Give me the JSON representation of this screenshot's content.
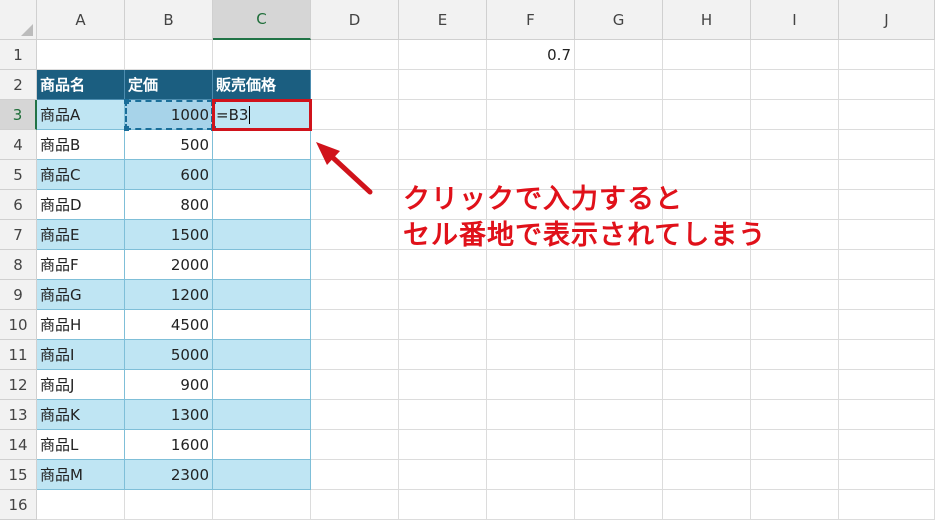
{
  "sheet": {
    "columns": [
      "A",
      "B",
      "C",
      "D",
      "E",
      "F",
      "G",
      "H",
      "I",
      "J"
    ],
    "rows": [
      "1",
      "2",
      "3",
      "4",
      "5",
      "6",
      "7",
      "8",
      "9",
      "10",
      "11",
      "12",
      "13",
      "14",
      "15",
      "16"
    ],
    "f1_value": "0.7",
    "table": {
      "headers": [
        "商品名",
        "定価",
        "販売価格"
      ],
      "items": [
        {
          "name": "商品A",
          "price": "1000"
        },
        {
          "name": "商品B",
          "price": "500"
        },
        {
          "name": "商品C",
          "price": "600"
        },
        {
          "name": "商品D",
          "price": "800"
        },
        {
          "name": "商品E",
          "price": "1500"
        },
        {
          "name": "商品F",
          "price": "2000"
        },
        {
          "name": "商品G",
          "price": "1200"
        },
        {
          "name": "商品H",
          "price": "4500"
        },
        {
          "name": "商品I",
          "price": "5000"
        },
        {
          "name": "商品J",
          "price": "900"
        },
        {
          "name": "商品K",
          "price": "1300"
        },
        {
          "name": "商品L",
          "price": "1600"
        },
        {
          "name": "商品M",
          "price": "2300"
        }
      ]
    },
    "active_cell": "C3",
    "active_formula": "=B3",
    "band_color": "#bfe5f3",
    "header_fill": "#1b5e80"
  },
  "annotation": {
    "line1": "クリックで入力すると",
    "line2": "セル番地で表示されてしまう",
    "color": "#e0111a"
  }
}
